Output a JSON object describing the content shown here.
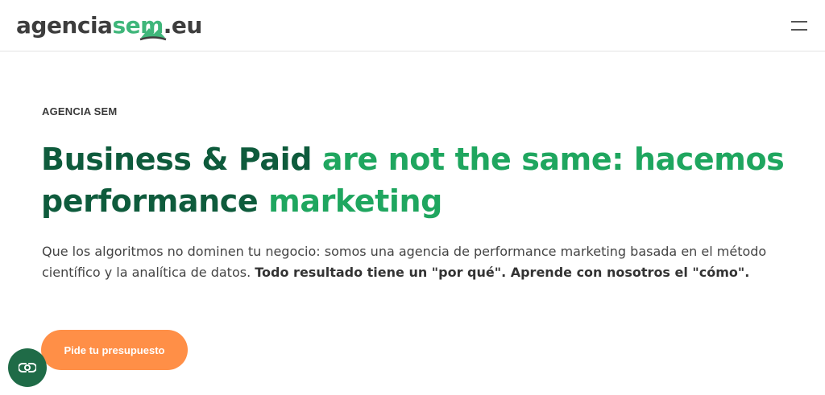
{
  "header": {
    "logo": {
      "part1": "agencia",
      "part2": "sem",
      "part3": ".eu"
    },
    "menu_icon": "hamburger-menu-icon"
  },
  "hero": {
    "eyebrow": "AGENCIA SEM",
    "headline_dark": "Business & Paid ",
    "headline_green_1": "are not the same: hacemos",
    "headline_dark_2": "performance ",
    "headline_green_2": "marketing",
    "lead_normal": "Que los algoritmos no dominen tu negocio: somos una agencia de performance marketing basada en el método científico y la analítica de datos. ",
    "lead_bold": "Todo resultado tiene un \"por qué\". Aprende con nosotros el \"cómo\".",
    "cta_label": "Pide tu presupuesto"
  },
  "widgets": {
    "cookie_icon": "cookie-consent-icon"
  },
  "colors": {
    "dark_green": "#0e5b3c",
    "green": "#1fa65f",
    "orange": "#ff8f47",
    "cookie_bg": "#1f6b47"
  }
}
